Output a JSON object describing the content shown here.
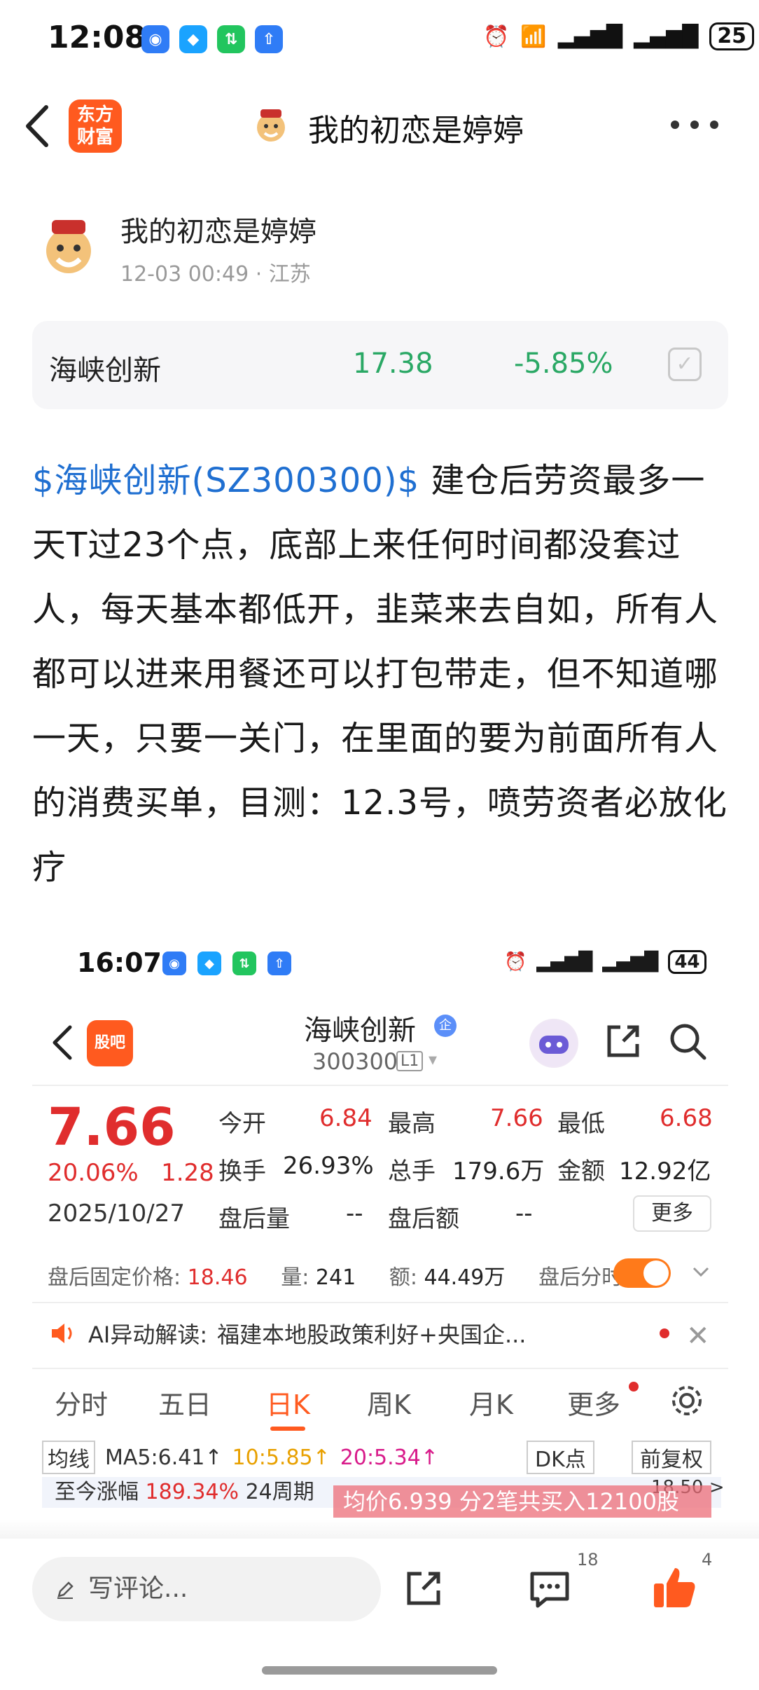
{
  "status_bar": {
    "time": "12:08",
    "battery": "25"
  },
  "header": {
    "app_logo": "东方财富",
    "title": "我的初恋是婷婷"
  },
  "author": {
    "name": "我的初恋是婷婷",
    "meta": "12-03 00:49 · 江苏"
  },
  "stock_card": {
    "name": "海峡创新",
    "price": "17.38",
    "change_pct": "-5.85%",
    "price_color": "#2aa865"
  },
  "post": {
    "cashtag": "$海峡创新(SZ300300)$",
    "text": " 建仓后劳资最多一天T过23个点，底部上来任何时间都没套过人，每天基本都低开，韭菜来去自如，所有人都可以进来用餐还可以打包带走，但不知道哪一天，只要一关门，在里面的要为前面所有人的消费买单，目测：12.3号，喷劳资者必放化疗"
  },
  "embedded": {
    "status_time": "16:07",
    "battery": "44",
    "app_logo": "股吧",
    "stock_name": "海峡创新",
    "badge": "企",
    "code": "300300",
    "level": "L1",
    "price": "7.66",
    "change_pct": "20.06%",
    "change": "1.28",
    "date": "2025/10/27",
    "quote": {
      "open_label": "今开",
      "open": "6.84",
      "high_label": "最高",
      "high": "7.66",
      "low_label": "最低",
      "low": "6.68",
      "turnover_label": "换手",
      "turnover": "26.93%",
      "volume_label": "总手",
      "volume": "179.6万",
      "amount_label": "金额",
      "amount": "12.92亿",
      "ah_vol_label": "盘后量",
      "ah_vol": "--",
      "ah_amt_label": "盘后额",
      "ah_amt": "--",
      "more": "更多"
    },
    "fixed": {
      "label": "盘后固定价格:",
      "price": "18.46",
      "vol_label": "量:",
      "vol": "241",
      "amt_label": "额:",
      "amt": "44.49万",
      "minute_label": "盘后分时"
    },
    "ai": {
      "label": "AI异动解读:",
      "text": "福建本地股政策利好+央国企..."
    },
    "tabs": [
      "分时",
      "五日",
      "日K",
      "周K",
      "月K",
      "更多"
    ],
    "active_tab": "日K",
    "ma": {
      "selector": "均线",
      "ma5": "MA5:6.41↑",
      "ma10": "10:5.85↑",
      "ma20": "20:5.34↑",
      "dk": "DK点",
      "adjust": "前复权"
    },
    "gain": {
      "label": "至今涨幅",
      "value": "189.34%",
      "period": "24周期"
    },
    "buy_note": "均价6.939  分2笔共买入12100股",
    "price_tag": "18.50 >"
  },
  "bottom": {
    "comment_placeholder": "写评论...",
    "comment_count": "18",
    "like_count": "4"
  },
  "colors": {
    "up": "#e02d2d",
    "down": "#2aa865",
    "accent": "#ff5a1f",
    "link": "#1f6fd1"
  }
}
